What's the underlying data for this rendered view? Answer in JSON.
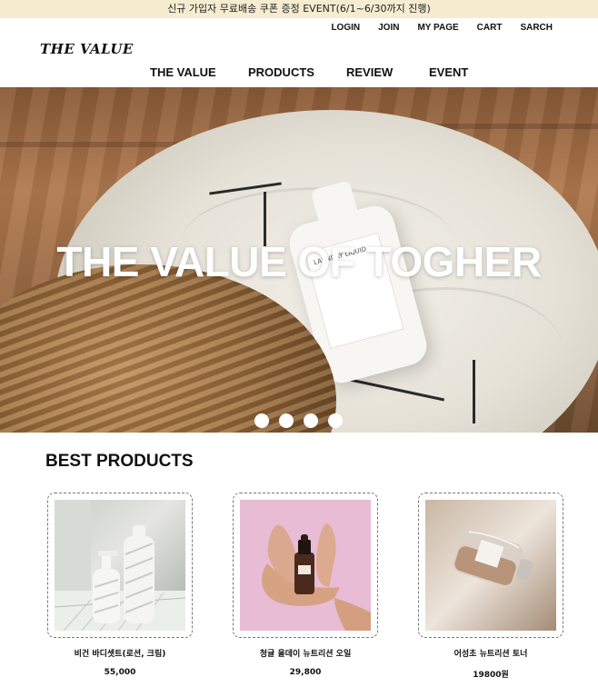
{
  "topbar": {
    "notice": "신규 가입자 무료배송 쿠폰 증정 EVENT(6/1~6/30까지 진행)"
  },
  "util_nav": [
    "LOGIN",
    "JOIN",
    "MY PAGE",
    "CART",
    "SARCH"
  ],
  "logo": {
    "text": "THE VALUE"
  },
  "main_nav": [
    "THE VALUE",
    "PRODUCTS",
    "REVIEW",
    "EVENT"
  ],
  "hero": {
    "title": "THE VALUE OF TOGHER",
    "bottle_label": "LAUNDRY LIQUID",
    "slide_count": 4
  },
  "best": {
    "title": "BEST PRODUCTS",
    "products": [
      {
        "name": "비건 바디셋트(로션, 크림)",
        "price": "55,000"
      },
      {
        "name": "청귤 올데이 뉴트리션 오일",
        "price": "29,800"
      },
      {
        "name": "어성초 뉴트리션 토너",
        "price": "19800원"
      }
    ]
  },
  "colors": {
    "topbar_bg": "#f6ecd0",
    "text": "#111111",
    "hero_title": "#ffffff"
  }
}
